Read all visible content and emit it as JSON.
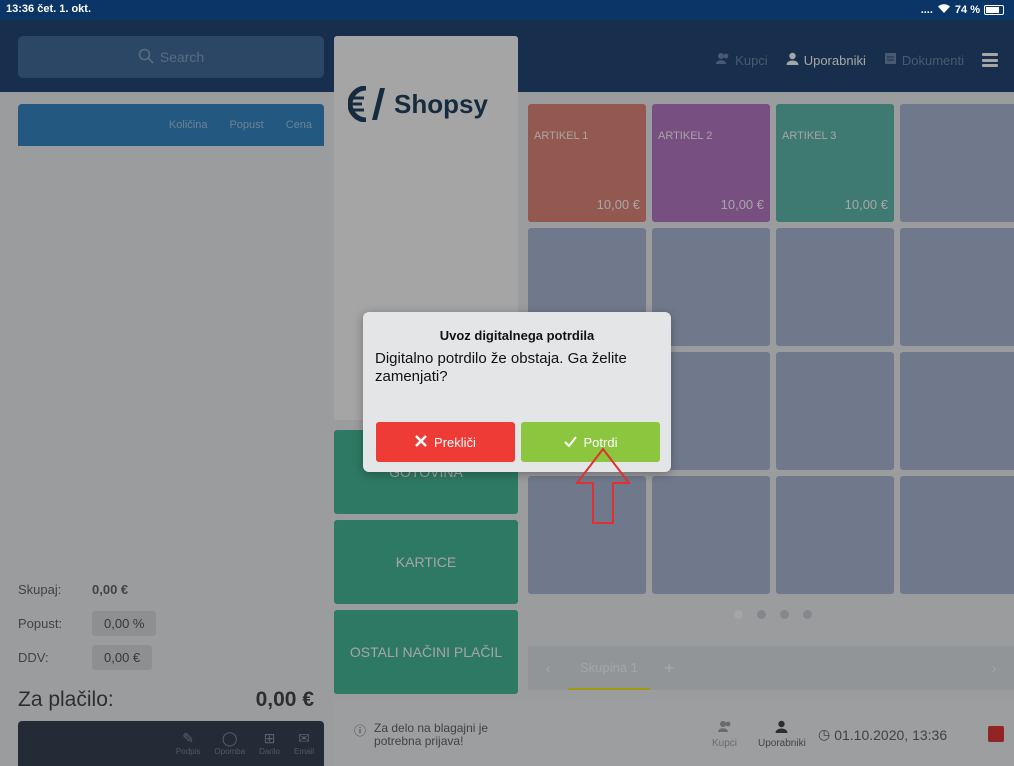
{
  "status": {
    "time": "13:36",
    "date": "čet. 1. okt.",
    "dots": "....",
    "battery": "74 %"
  },
  "search": {
    "placeholder": "Search"
  },
  "nav": {
    "customers": "Kupci",
    "users": "Uporabniki",
    "documents": "Dokumenti"
  },
  "cart": {
    "columns": [
      "Količina",
      "Popust",
      "Cena"
    ],
    "total_label": "Skupaj:",
    "total_value": "0,00 €",
    "discount_label": "Popust:",
    "discount_value": "0,00 %",
    "vat_label": "DDV:",
    "vat_value": "0,00 €",
    "pay_label": "Za plačilo:",
    "pay_value": "0,00 €"
  },
  "bottom_actions": [
    "Podpis",
    "Opomba",
    "Darilo",
    "Email"
  ],
  "brand": {
    "name": "Shopsy"
  },
  "payment_buttons": [
    "GOTOVINA",
    "KARTICE",
    "OSTALI NAČINI PLAČIL"
  ],
  "articles": [
    {
      "name": "ARTIKEL 1",
      "price": "10,00 €",
      "color": "#e17d6e"
    },
    {
      "name": "ARTIKEL 2",
      "price": "10,00 €",
      "color": "#b26cc1"
    },
    {
      "name": "ARTIKEL 3",
      "price": "10,00 €",
      "color": "#4fb5a5"
    }
  ],
  "empty_tile_color": "#a4b3d5",
  "pager": {
    "pages": 4,
    "active": 1
  },
  "groups": {
    "active": "Skupina 1"
  },
  "footer": {
    "login_notice": "Za delo na blagajni je potrebna prijava!",
    "customers": "Kupci",
    "users": "Uporabniki",
    "datetime": "01.10.2020, 13:36"
  },
  "dialog": {
    "title": "Uvoz digitalnega potrdila",
    "message": "Digitalno potrdilo že obstaja. Ga želite zamenjati?",
    "cancel_label": "Prekliči",
    "confirm_label": "Potrdi"
  }
}
